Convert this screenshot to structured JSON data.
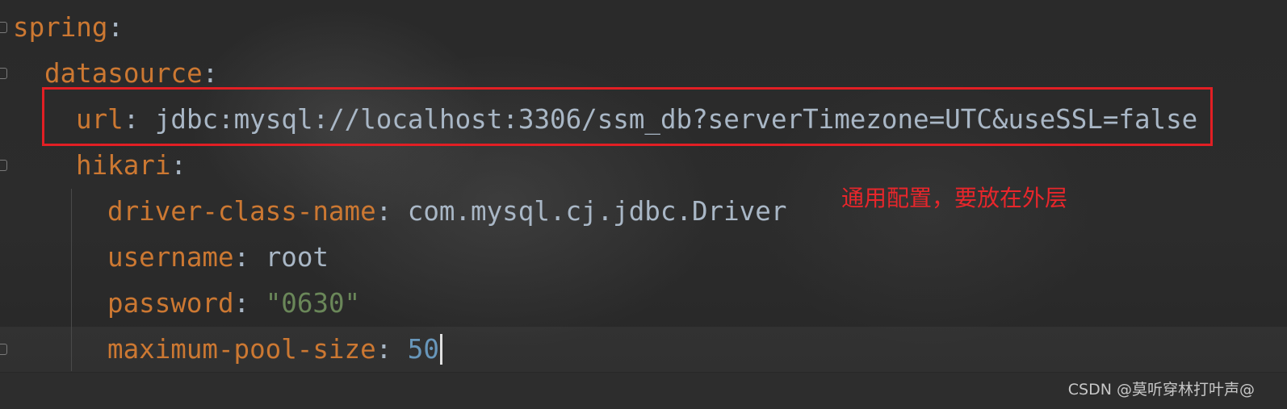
{
  "editor": {
    "lines": [
      {
        "key": "spring",
        "colon": ":"
      },
      {
        "key": "datasource",
        "colon": ":"
      },
      {
        "key": "url",
        "colon": ":",
        "value": " jdbc:mysql://localhost:3306/ssm_db?serverTimezone=UTC&useSSL=false"
      },
      {
        "key": "hikari",
        "colon": ":"
      },
      {
        "key": "driver-class-name",
        "colon": ":",
        "value": " com.mysql.cj.jdbc.Driver"
      },
      {
        "key": "username",
        "colon": ":",
        "value": " root"
      },
      {
        "key": "password",
        "colon": ":",
        "value": " \"0630\""
      },
      {
        "key": "maximum-pool-size",
        "colon": ":",
        "value": " 50"
      }
    ]
  },
  "annotation": {
    "text": "通用配置，要放在外层",
    "color": "#e8262b"
  },
  "watermark": {
    "text": "CSDN @莫听穿林打叶声@"
  },
  "colors": {
    "background": "#2b2b2b",
    "key": "#cc7832",
    "plain": "#a9b7c6",
    "string": "#6a8759",
    "number": "#6897bb",
    "highlight_border": "#e21f24"
  }
}
